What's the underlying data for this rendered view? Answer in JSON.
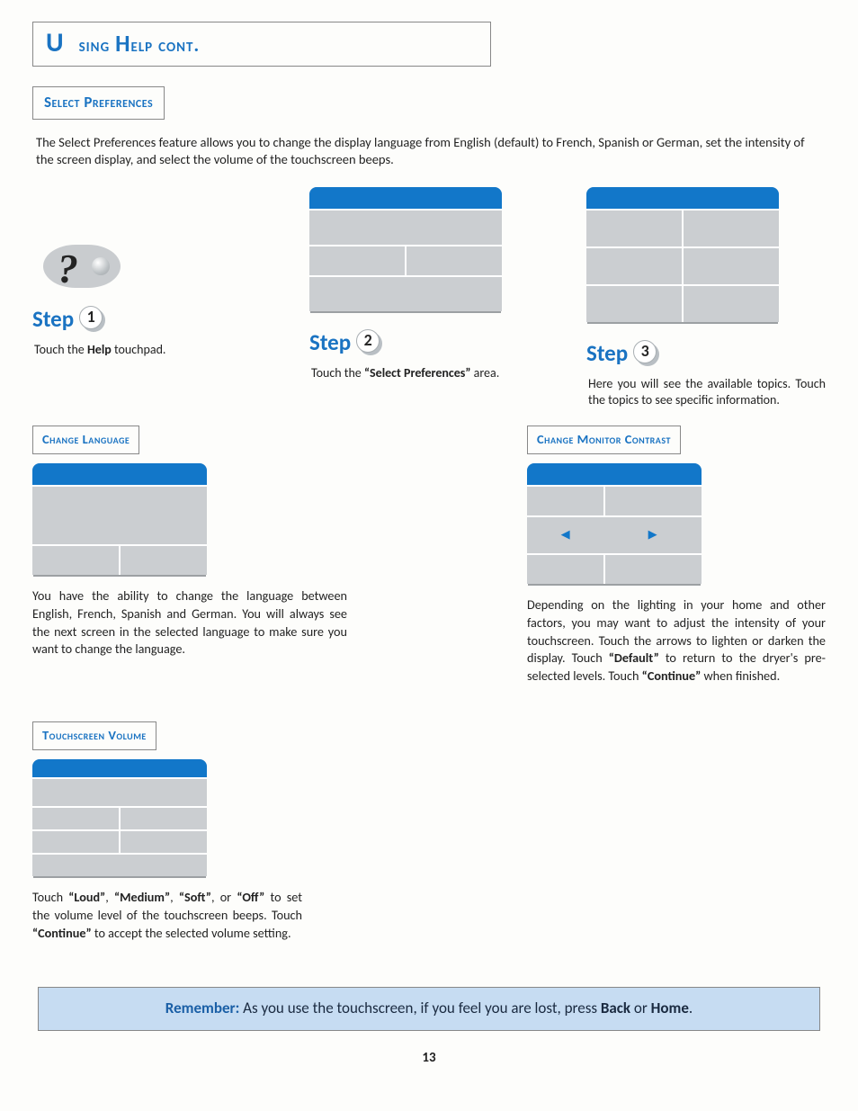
{
  "page_title": "Using Help cont.",
  "section_title": "Select Preferences",
  "intro": "The Select Preferences feature allows you to change the display language from English (default) to French, Spanish or German, set the intensity of the screen display, and select the volume of the touchscreen beeps.",
  "steps": {
    "label_prefix": "Step",
    "s1": {
      "num": "1",
      "text_pre": "Touch the ",
      "text_bold": "Help",
      "text_post": " touchpad."
    },
    "s2": {
      "num": "2",
      "text_pre": "Touch the  ",
      "text_bold": "“Select Preferences”",
      "text_post": " area."
    },
    "s3": {
      "num": "3",
      "text": "Here you will see the available topics.  Touch the topics to see specific information."
    }
  },
  "blocks": {
    "lang": {
      "title": "Change Language",
      "para": "You have the ability to change the language between English, French, Spanish and German. You will always see the next screen in the selected language to make sure you want to change the language."
    },
    "contrast": {
      "title": "Change Monitor Contrast",
      "para_parts": {
        "p1": "Depending on the lighting in your home and other factors, you may want to adjust the intensity of your touchscreen.  Touch the arrows to lighten or darken the  display.  Touch ",
        "b1": "“Default”",
        "p2": " to return to the dryer's pre-selected levels. Touch ",
        "b2": "“Continue”",
        "p3": " when finished."
      },
      "arrows": {
        "left": "◀",
        "right": "▶"
      }
    },
    "volume": {
      "title": "Touchscreen Volume",
      "para_parts": {
        "p1": "Touch ",
        "b1": "“Loud”",
        "p2": ", ",
        "b2": "“Medium”",
        "p3": ", ",
        "b3": "“Soft”",
        "p4": ", or ",
        "b4": "“Off”",
        "p5": " to set the volume level of the touchscreen beeps.  Touch ",
        "b5": "“Continue”",
        "p6": " to accept the selected volume setting."
      }
    }
  },
  "reminder": {
    "label": "Remember:",
    "text_pre": "  As you use the touchscreen, if you feel you are lost, press ",
    "b1": "Back",
    "mid": " or ",
    "b2": "Home",
    "end": "."
  },
  "page_number": "13"
}
